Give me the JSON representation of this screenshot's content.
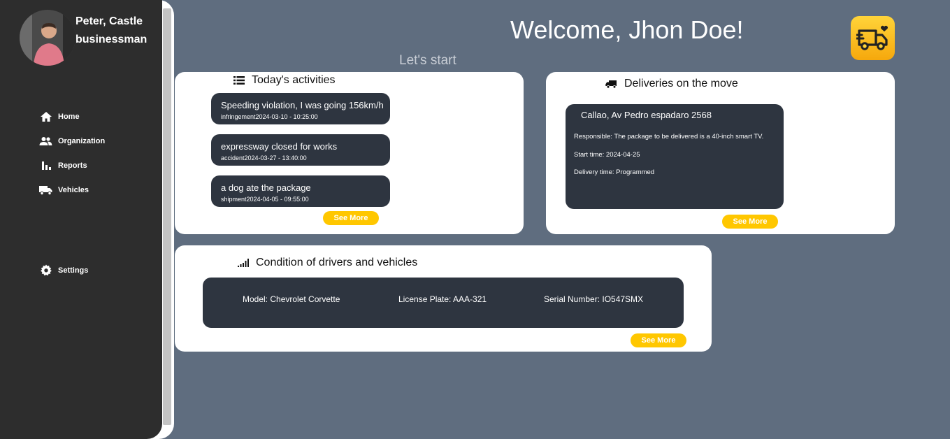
{
  "user": {
    "first_line": "Peter, Castle",
    "second_line": "businessman"
  },
  "nav": {
    "items": [
      {
        "label": "Home",
        "icon": "home-icon"
      },
      {
        "label": "Organization",
        "icon": "people-icon"
      },
      {
        "label": "Reports",
        "icon": "bar-chart-icon"
      },
      {
        "label": "Vehicles",
        "icon": "truck-icon"
      }
    ],
    "settings": {
      "label": "Settings",
      "icon": "gear-icon"
    }
  },
  "header": {
    "welcome": "Welcome, Jhon Doe!",
    "subtitle": "Let's start"
  },
  "activities": {
    "title": "Today's activities",
    "items": [
      {
        "text": "Speeding violation, I was going 156km/h",
        "meta": "infringement2024-03-10 - 10:25:00"
      },
      {
        "text": "expressway closed for works",
        "meta": "accident2024-03-27 - 13:40:00"
      },
      {
        "text": "a dog ate the package",
        "meta": "shipment2024-04-05 - 09:55:00"
      }
    ],
    "see_more": "See More"
  },
  "deliveries": {
    "title": "Deliveries on the move",
    "address": "Callao, Av Pedro espadaro 2568",
    "responsible": "Responsible: The package to be delivered is a 40-inch smart TV.",
    "start_time": "Start time: 2024-04-25",
    "delivery_time": "Delivery time: Programmed",
    "see_more": "See More"
  },
  "condition": {
    "title": "Condition of drivers and vehicles",
    "model": "Model: Chevrolet Corvette",
    "plate": "License Plate: AAA-321",
    "serial": "Serial Number: IO547SMX",
    "see_more": "See More"
  },
  "colors": {
    "background": "#5f6d7f",
    "sidebar": "#2d2d2d",
    "dark_box": "#2e3540",
    "accent": "#ffc700"
  }
}
